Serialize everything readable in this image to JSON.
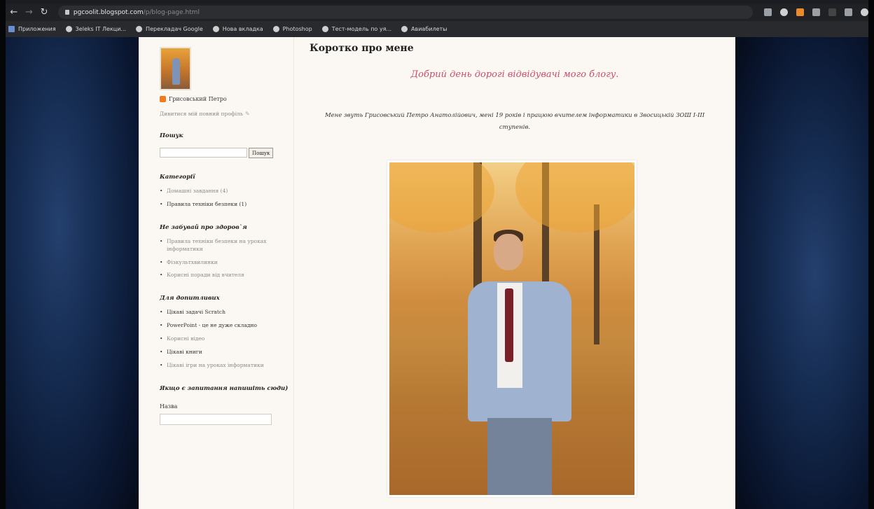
{
  "browser": {
    "url_host": "pgcoolit.blogspot.com",
    "url_path": "/p/blog-page.html",
    "bookmarks": [
      {
        "label": "Приложения",
        "icon": "grid-icon"
      },
      {
        "label": "Зеleks IT Лекци...",
        "icon": "globe-icon"
      },
      {
        "label": "Перекладач Google",
        "icon": "globe-icon"
      },
      {
        "label": "Нова вкладка",
        "icon": "globe-icon"
      },
      {
        "label": "Photoshop",
        "icon": "globe-icon"
      },
      {
        "label": "Тест-модель по уя...",
        "icon": "globe-icon"
      },
      {
        "label": "Авиабилеты",
        "icon": "globe-icon"
      }
    ]
  },
  "sidebar": {
    "profile_name": "Грисовський Петро",
    "profile_link": "Дивитися мій повний профіль",
    "search_heading": "Пошук",
    "search_button": "Пошук",
    "categories_heading": "Категорії",
    "categories": [
      {
        "label": "Домашні завдання (4)",
        "dim": true
      },
      {
        "label": "Правила техніки безпеки (1)",
        "dim": false
      }
    ],
    "health_heading": "Не забувай про здоров`я",
    "health_items": [
      {
        "label": "Правила техніки безпеки на уроках інформатики",
        "dim": true
      },
      {
        "label": "Фізкультхвилинки",
        "dim": true
      },
      {
        "label": "Корисні поради від вчителя",
        "dim": true
      }
    ],
    "curious_heading": "Для допитливих",
    "curious_items": [
      {
        "label": "Цікаві задачі Scratch",
        "dim": false
      },
      {
        "label": "PowerPoint - це не дуже складно",
        "dim": false
      },
      {
        "label": "Корисні відео",
        "dim": true
      },
      {
        "label": "Цікаві книги",
        "dim": false
      },
      {
        "label": "Цікаві ігри на уроках інформатики",
        "dim": true
      }
    ],
    "contact_heading": "Якщо є запитання напишіть сюди)",
    "name_label": "Назва"
  },
  "main": {
    "post_title": "Коротко про мене",
    "greeting": "Добрий день дорогі відвідувачі мого блогу.",
    "intro": "Мене звуть Грисовський Петро Анатолійович, мені 19 років і працюю вчителем інформатики в Звосицькій ЗОШ І-ІІІ ступенів."
  },
  "colors": {
    "accent_greeting": "#cc4d6a",
    "page_bg": "#fbf8f3",
    "chrome_bg": "#202124"
  }
}
